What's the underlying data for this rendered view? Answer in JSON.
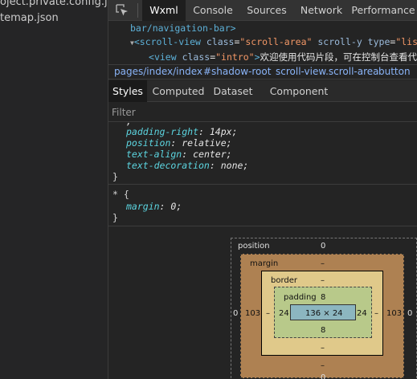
{
  "file_tree": {
    "items": [
      "oject.private.config.js...",
      "temap.json"
    ]
  },
  "top_tabs": [
    "Wxml",
    "Console",
    "Sources",
    "Network",
    "Performance"
  ],
  "active_top_tab": "Wxml",
  "dom_tree": {
    "line1": {
      "text": "bar/navigation-bar>"
    },
    "line2": {
      "arrow": "▼",
      "open": "<",
      "tag": "scroll-view",
      "attr1_name": " class",
      "attr1_eq": "=",
      "attr1_value": "\"scroll-area\"",
      "attr2_name": " scroll-y",
      "attr3_name": " type",
      "attr3_eq": "=",
      "attr3_value": "\"list\""
    },
    "line3": {
      "open": "<",
      "tag": "view",
      "attr1_name": " class",
      "attr1_eq": "=",
      "attr1_value": "\"intro\"",
      "close": ">",
      "text": "欢迎使用代码片段，可在控制台查看代"
    }
  },
  "breadcrumbs": [
    "pages/index/index",
    "#shadow-root",
    "scroll-view.scroll-area",
    "button"
  ],
  "sub_tabs": [
    "Styles",
    "Computed",
    "Dataset",
    "Component Data"
  ],
  "active_sub_tab": "Styles",
  "filter": {
    "placeholder": "Filter",
    "value": ""
  },
  "styles": {
    "rule1": [
      {
        "prop": "padding-right",
        "value": "14px"
      },
      {
        "prop": "position",
        "value": "relative"
      },
      {
        "prop": "text-align",
        "value": "center"
      },
      {
        "prop": "text-decoration",
        "value": "none"
      }
    ],
    "rule1_close": "}",
    "rule2_selector": "* {",
    "rule2": [
      {
        "prop": "margin",
        "value": "0"
      }
    ],
    "rule2_close": "}"
  },
  "box_model": {
    "position_label": "position",
    "position_top": "0",
    "position_left": "0",
    "position_right": "0",
    "margin_label": "margin",
    "margin_top": "–",
    "margin_left": "103",
    "margin_right": "103",
    "margin_bottom": "–",
    "border_label": "border",
    "border_top": "–",
    "border_left": "–",
    "border_right": "–",
    "border_bottom": "–",
    "padding_label": "padding",
    "padding_top": "8",
    "padding_left": "24",
    "padding_right": "24",
    "padding_bottom": "8",
    "content_size": "136 × 24",
    "position_bottom": "0"
  },
  "colors": {
    "margin_box": "#ae8152",
    "border_box": "#e0c98a",
    "padding_box": "#b8c98a",
    "content_box": "#8cb6c0"
  }
}
